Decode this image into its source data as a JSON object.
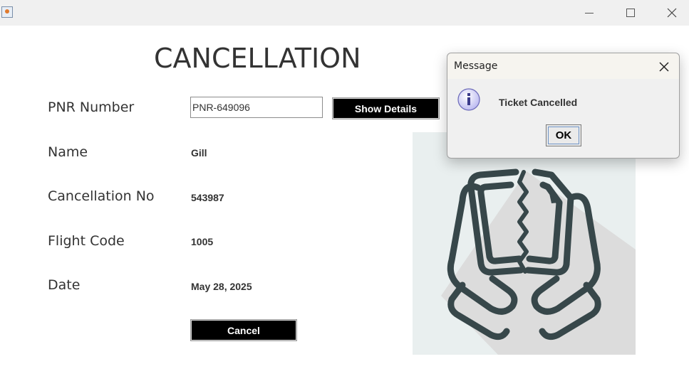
{
  "window": {
    "title": ""
  },
  "form": {
    "title": "CANCELLATION",
    "pnr_label": "PNR Number",
    "pnr_value": "PNR-649096",
    "show_details_label": "Show Details",
    "name_label": "Name",
    "name_value": "Gill",
    "cancellation_no_label": "Cancellation No",
    "cancellation_no_value": "543987",
    "flight_code_label": "Flight Code",
    "flight_code_value": "1005",
    "date_label": "Date",
    "date_value": "May 28, 2025",
    "cancel_label": "Cancel"
  },
  "illustration": {
    "icon": "torn-ticket-hands-icon",
    "background": "#e9efef",
    "stroke": "#37474a"
  },
  "dialog": {
    "title": "Message",
    "message": "Ticket Cancelled",
    "ok_label": "OK",
    "icon": "info-icon"
  },
  "colors": {
    "button_bg": "#000000",
    "button_text": "#ffffff",
    "text": "#333333"
  }
}
